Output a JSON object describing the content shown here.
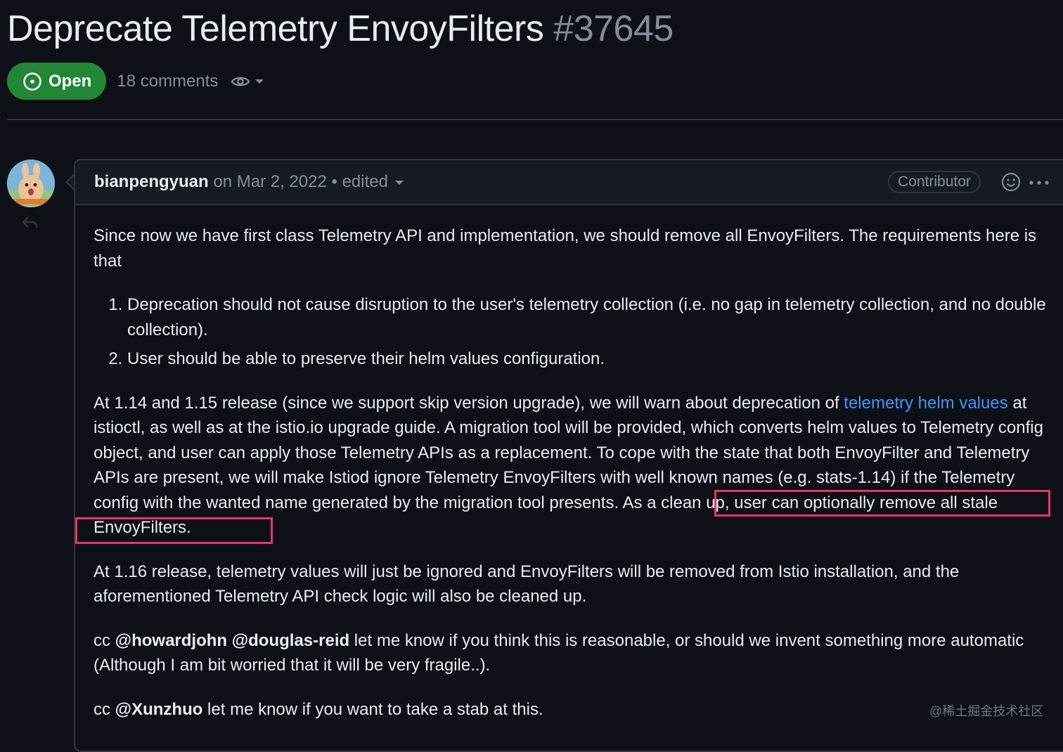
{
  "issue": {
    "title": "Deprecate Telemetry EnvoyFilters",
    "number": "#37645",
    "status_label": "Open",
    "comments_count": "18 comments"
  },
  "icons": {
    "status": "issue-open-icon",
    "watch": "eye-icon",
    "reaction": "smiley-icon",
    "more": "kebab-horizontal-icon",
    "reply": "reply-icon"
  },
  "colors": {
    "background": "#0d1117",
    "open_badge": "#238636",
    "link": "#4493f8",
    "highlight_box": "#e8336e"
  },
  "comment": {
    "author": "bianpengyuan",
    "on": "on",
    "date": "Mar 2, 2022",
    "separator": "•",
    "edited": "edited",
    "role": "Contributor",
    "intro": "Since now we have first class Telemetry API and implementation, we should remove all EnvoyFilters. The requirements here is that",
    "requirements": [
      "Deprecation should not cause disruption to the user's telemetry collection (i.e. no gap in telemetry collection, and no double collection).",
      "User should be able to preserve their helm values configuration."
    ],
    "p2_before_link": "At 1.14 and 1.15 release (since we support skip version upgrade), we will warn about deprecation of ",
    "p2_link": "telemetry helm values",
    "p2_after_link": " at istioctl, as well as at the istio.io upgrade guide. A migration tool will be provided, which converts helm values to Telemetry config object, and user can apply those Telemetry APIs as a replacement. To cope with the state that both EnvoyFilter and Telemetry APIs are present, we will make Istiod ignore Telemetry EnvoyFilters with well known names (e.g. stats-1.14) if the Telemetry config with the wanted name generated by the migration tool presents. As a clean up, user can optionally remove all stale EnvoyFilters.",
    "p3": "At 1.16 release, telemetry values will just be ignored and EnvoyFilters will be removed from Istio installation, and the aforementioned Telemetry API check logic will also be cleaned up.",
    "p4_prefix": "cc ",
    "p4_mentions": "@howardjohn @douglas-reid",
    "p4_rest": " let me know if you think this is reasonable, or should we invent something more automatic (Although I am bit worried that it will be very fragile..).",
    "p5_prefix": "cc ",
    "p5_mention": "@Xunzhuo",
    "p5_rest": " let me know if you want to take a stab at this."
  },
  "watermark": "@稀土掘金技术社区"
}
